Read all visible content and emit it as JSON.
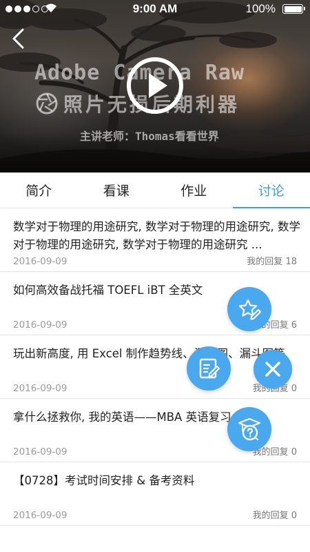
{
  "status_bar": {
    "time": "9:00 AM",
    "battery": "100%",
    "signal_bars_filled": 3,
    "signal_bars_total": 5
  },
  "hero": {
    "title_line1": "Adobe Camera Raw",
    "title_line2": "照片无损后期利器",
    "teacher": "主讲老师：Thomas看看世界",
    "icons": {
      "back": "back-arrow-icon",
      "play": "play-icon",
      "aperture": "aperture-icon"
    }
  },
  "tabs": [
    {
      "label": "简介",
      "active": false
    },
    {
      "label": "看课",
      "active": false
    },
    {
      "label": "作业",
      "active": false
    },
    {
      "label": "讨论",
      "active": true
    }
  ],
  "discussions": [
    {
      "title": "数学对于物理的用途研究, 数学对于物理的用途研究, 数学对于物理的用途研究, 数学对于物理的用途研究 ...",
      "date": "2016-09-09",
      "reply_label": "我的回复",
      "reply_count": "18"
    },
    {
      "title": "如何高效备战托福 TOEFL iBT 全英文",
      "date": "2016-09-09",
      "reply_label": "我的回复",
      "reply_count": "6"
    },
    {
      "title": "玩出新高度, 用 Excel 制作趋势线、瀑布图、漏斗图等",
      "date": "2016-09-09",
      "reply_label": "我的回复",
      "reply_count": "0"
    },
    {
      "title": "拿什么拯救你, 我的英语——MBA 英语复习",
      "date": "2016-09-09",
      "reply_label": "我的回复",
      "reply_count": "0"
    },
    {
      "title": "【0728】考试时间安排 & 备考资料",
      "date": "2016-09-09",
      "reply_label": "我的回复",
      "reply_count": "0"
    }
  ],
  "fabs": {
    "favorite": "star-pencil-icon",
    "note": "note-edit-icon",
    "close": "close-icon",
    "question": "question-graduation-icon"
  },
  "colors": {
    "accent": "#3a9de3",
    "fab": "#4aa8ee",
    "text": "#222222",
    "meta": "#999999"
  }
}
